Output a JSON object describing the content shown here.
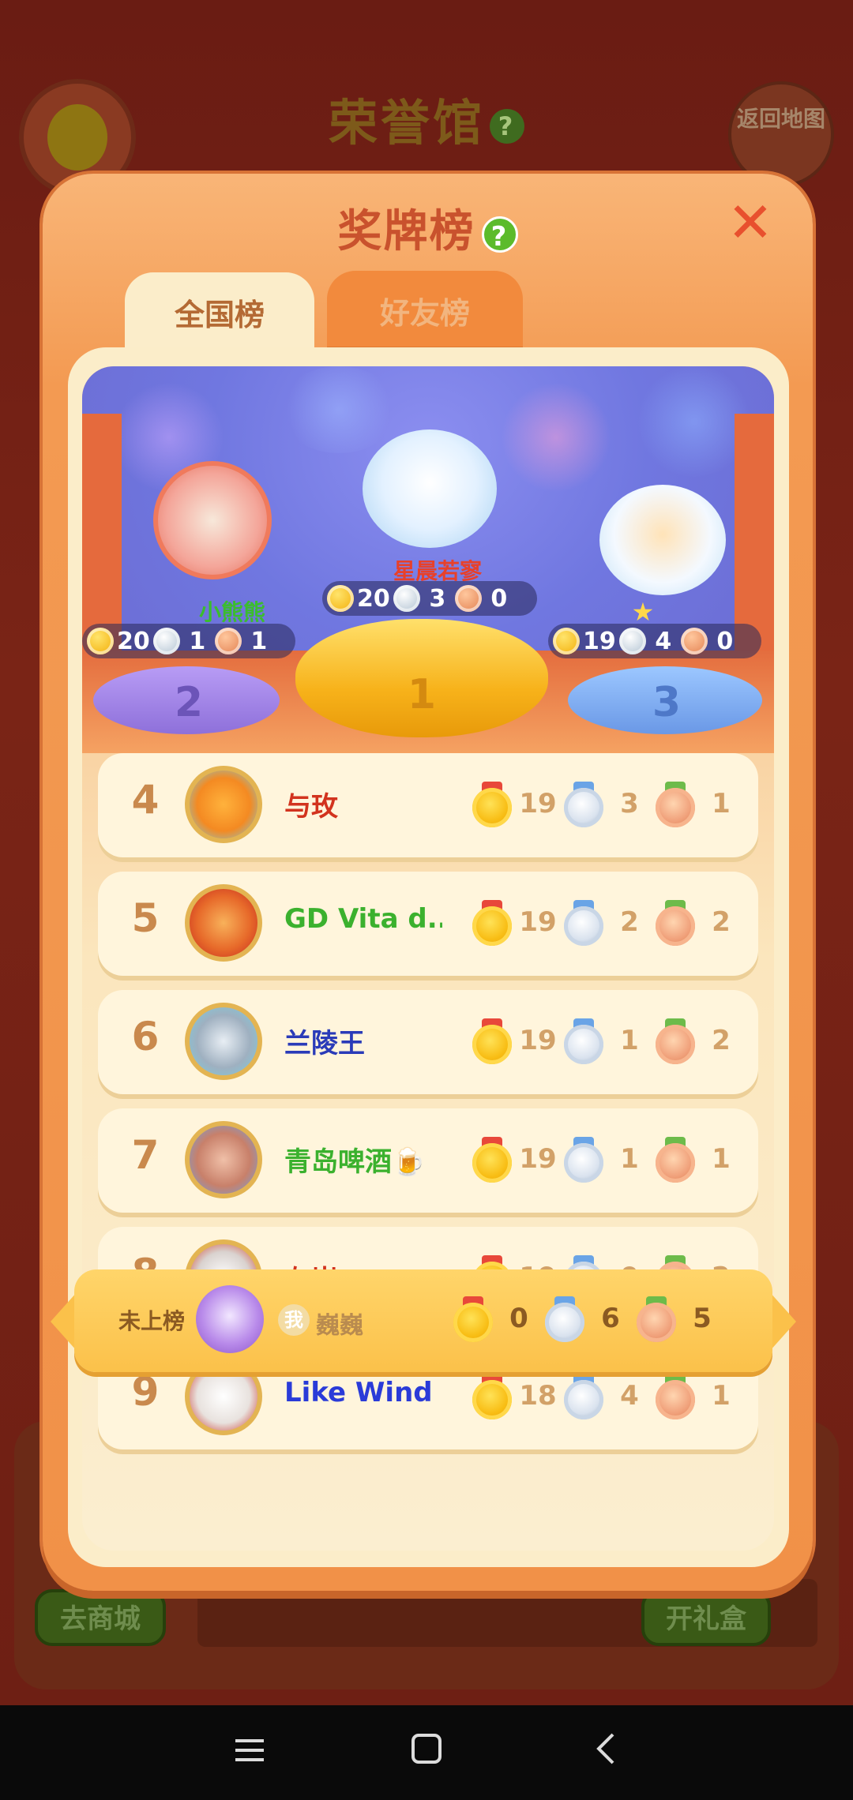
{
  "background": {
    "hall_title": "荣誉馆",
    "help_mark": "?",
    "return_label": "返回地图",
    "shop_button": "去商城",
    "gift_button": "开礼盒"
  },
  "modal": {
    "title": "奖牌榜",
    "help_mark": "?",
    "close_symbol": "✕",
    "tabs": [
      {
        "label": "全国榜",
        "active": true
      },
      {
        "label": "好友榜",
        "active": false
      }
    ]
  },
  "podium": [
    {
      "place": "2",
      "name": "小熊熊",
      "name_color": "#3bbd2e",
      "gold": "20",
      "silver": "1",
      "bronze": "1"
    },
    {
      "place": "1",
      "name": "星晨若寥",
      "name_color": "#e8402a",
      "gold": "20",
      "silver": "3",
      "bronze": "0"
    },
    {
      "place": "3",
      "name": "★",
      "name_color": "#ffd84a",
      "gold": "19",
      "silver": "4",
      "bronze": "0"
    }
  ],
  "rows": [
    {
      "rank": "4",
      "name": "与玫",
      "name_color": "#d2331e",
      "gold": "19",
      "silver": "3",
      "bronze": "1"
    },
    {
      "rank": "5",
      "name": "GD Vita d...",
      "name_color": "#3bb12e",
      "gold": "19",
      "silver": "2",
      "bronze": "2"
    },
    {
      "rank": "6",
      "name": "兰陵王",
      "name_color": "#2a3bb8",
      "gold": "19",
      "silver": "1",
      "bronze": "2"
    },
    {
      "rank": "7",
      "name": "青岛啤酒🍺",
      "name_color": "#3bb12e",
      "gold": "19",
      "silver": "1",
      "bronze": "1"
    },
    {
      "rank": "8",
      "name": "左岸",
      "name_color": "#d2331e",
      "gold": "19",
      "silver": "0",
      "bronze": "2"
    },
    {
      "rank": "9",
      "name": "Like Wind",
      "name_color": "#2a3bd8",
      "gold": "18",
      "silver": "4",
      "bronze": "1"
    }
  ],
  "self": {
    "status": "未上榜",
    "tag": "我",
    "name": "巍巍",
    "gold": "0",
    "silver": "6",
    "bronze": "5"
  },
  "navbar": {
    "menu_icon": "menu-icon",
    "home_icon": "home-icon",
    "back_icon": "back-icon"
  }
}
